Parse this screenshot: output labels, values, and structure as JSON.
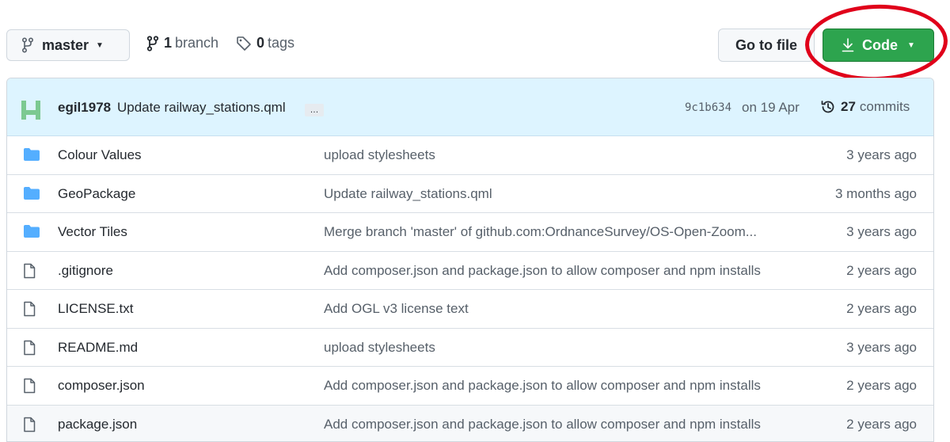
{
  "toolbar": {
    "branch_name": "master",
    "branches_count": "1",
    "branches_label": "branch",
    "tags_count": "0",
    "tags_label": "tags",
    "goto_file_label": "Go to file",
    "code_label": "Code"
  },
  "commit": {
    "author": "egil1978",
    "message": "Update railway_stations.qml",
    "ellipsis": "…",
    "sha": "9c1b634",
    "date": "on 19 Apr",
    "commits_count": "27",
    "commits_label": "commits"
  },
  "files": [
    {
      "type": "folder",
      "name": "Colour Values",
      "commit": "upload stylesheets",
      "age": "3 years ago"
    },
    {
      "type": "folder",
      "name": "GeoPackage",
      "commit": "Update railway_stations.qml",
      "age": "3 months ago"
    },
    {
      "type": "folder",
      "name": "Vector Tiles",
      "commit": "Merge branch 'master' of github.com:OrdnanceSurvey/OS-Open-Zoom...",
      "age": "3 years ago"
    },
    {
      "type": "file",
      "name": ".gitignore",
      "commit": "Add composer.json and package.json to allow composer and npm installs",
      "age": "2 years ago"
    },
    {
      "type": "file",
      "name": "LICENSE.txt",
      "commit": "Add OGL v3 license text",
      "age": "2 years ago"
    },
    {
      "type": "file",
      "name": "README.md",
      "commit": "upload stylesheets",
      "age": "3 years ago"
    },
    {
      "type": "file",
      "name": "composer.json",
      "commit": "Add composer.json and package.json to allow composer and npm installs",
      "age": "2 years ago"
    },
    {
      "type": "file",
      "name": "package.json",
      "commit": "Add composer.json and package.json to allow composer and npm installs",
      "age": "2 years ago"
    }
  ],
  "colors": {
    "code_button": "#2da44e",
    "highlight_ring": "#e0001a",
    "folder_icon": "#54aeff",
    "commit_bar": "#ddf4ff"
  }
}
